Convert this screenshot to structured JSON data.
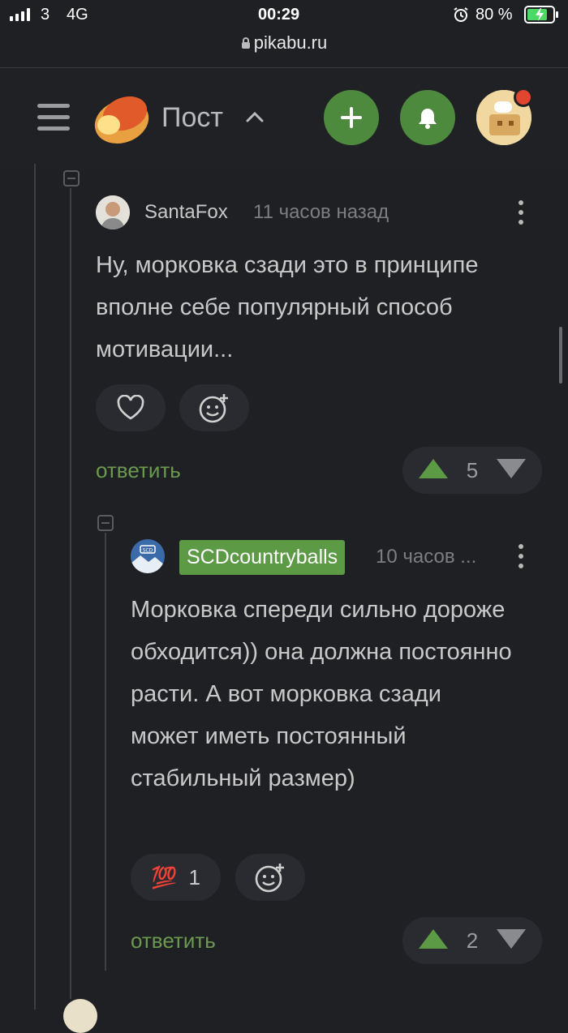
{
  "status_bar": {
    "carrier": "3",
    "network": "4G",
    "time": "00:29",
    "battery": "80 %"
  },
  "browser": {
    "url": "pikabu.ru"
  },
  "header": {
    "title": "Пост"
  },
  "comments": [
    {
      "author": "SantaFox",
      "time": "11 часов назад",
      "text": "Ну, морковка сзади это в принципе вполне себе популярный способ мотивации...",
      "reply_label": "ответить",
      "rating": "5"
    },
    {
      "author": "SCDcountryballs",
      "avatar_text": "SCD",
      "time": "10 часов ...",
      "text": "Морковка спереди сильно дороже обходится)) она должна постоянно расти. А вот морковка сзади может иметь постоянный стабильный размер)",
      "reaction_emoji": "💯",
      "reaction_count": "1",
      "reply_label": "ответить",
      "rating": "2"
    }
  ],
  "colors": {
    "accent": "#4e8a3e",
    "background": "#1f2024",
    "reply": "#6b9a4f"
  }
}
